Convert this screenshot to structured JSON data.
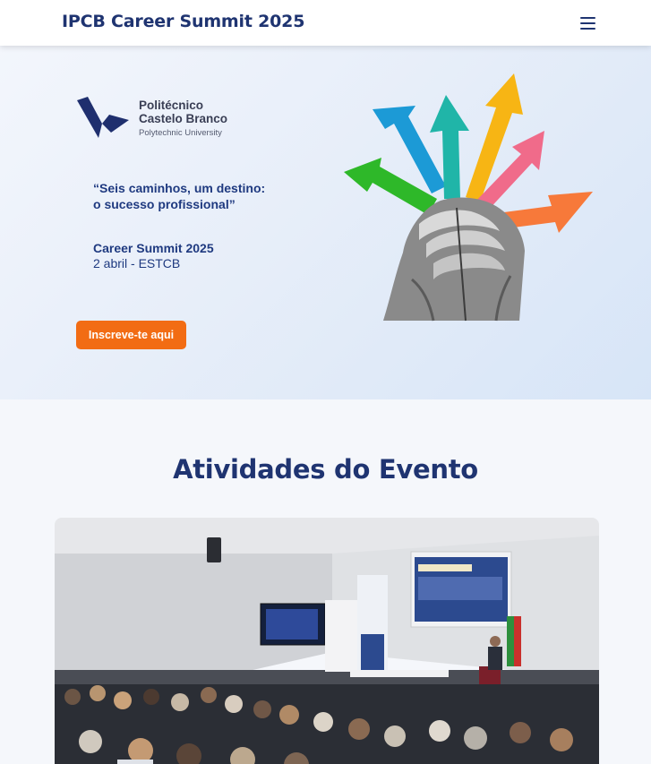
{
  "header": {
    "brand": "IPCB Career Summit 2025",
    "menu_icon": "hamburger-menu-icon"
  },
  "hero": {
    "logo": {
      "name_line1": "Politécnico",
      "name_line2": "Castelo Branco",
      "subtitle": "Polytechnic University"
    },
    "quote_line1": "“Seis caminhos, um destino:",
    "quote_line2": "o sucesso profissional”",
    "event_title": "Career Summit 2025",
    "event_details": "2 abril - ESTCB",
    "cta_label": "Inscreve-te aqui",
    "colors": {
      "cta": "#f26c14",
      "arrow_green": "#2eb829",
      "arrow_blue": "#1c9ad6",
      "arrow_teal": "#20b5a8",
      "arrow_yellow": "#f7b514",
      "arrow_pink": "#f06b8a",
      "arrow_orange": "#f7793a"
    }
  },
  "activities": {
    "title": "Atividades do Evento"
  },
  "theme": {
    "primary": "#1f3471",
    "background": "#f5f7fb"
  }
}
